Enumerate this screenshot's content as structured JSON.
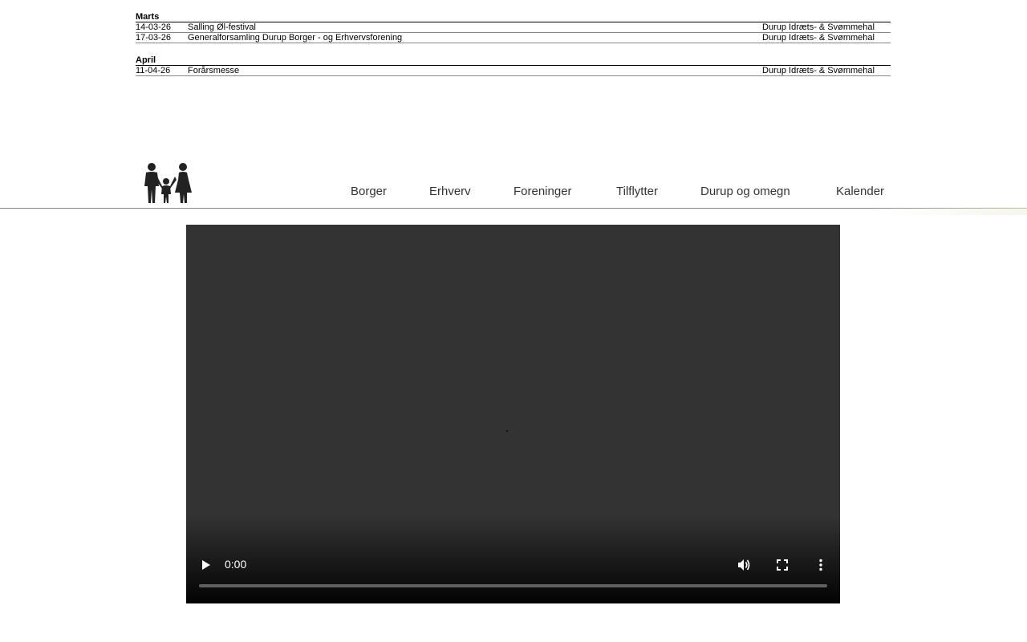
{
  "calendar": {
    "months": [
      {
        "name": "Marts",
        "events": [
          {
            "date": "14-03-26",
            "name": "Salling Øl-festival",
            "place": "Durup Idræts- & Svømmehal"
          },
          {
            "date": "17-03-26",
            "name": "Generalforsamling Durup Borger - og Erhvervsforening",
            "place": "Durup Idræts- & Svømmehal"
          }
        ]
      },
      {
        "name": "April",
        "events": [
          {
            "date": "11-04-26",
            "name": "Forårsmesse",
            "place": "Durup Idræts- & Svømmehal"
          }
        ]
      }
    ]
  },
  "header": {
    "logo_icon": "family-icon",
    "nav": [
      {
        "label": "Borger"
      },
      {
        "label": "Erhverv"
      },
      {
        "label": "Foreninger"
      },
      {
        "label": "Tilflytter"
      },
      {
        "label": "Durup og omegn"
      },
      {
        "label": "Kalender"
      }
    ]
  },
  "video": {
    "time": "0:00",
    "progress": 0,
    "icons": {
      "play": "play-icon",
      "volume": "volume-icon",
      "fullscreen": "fullscreen-icon",
      "more": "more-vert-icon"
    }
  },
  "colors": {
    "video_bg": "#333333",
    "nav_text": "#333333",
    "divider": "#888888"
  }
}
